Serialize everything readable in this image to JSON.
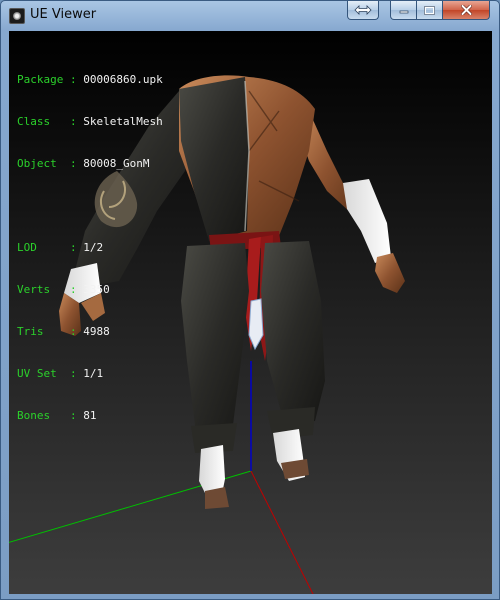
{
  "window": {
    "title": "UE Viewer",
    "icon": "ue-viewer-app-icon",
    "buttons": {
      "swap": "swap-arrows-icon",
      "minimize": "minimize-icon",
      "maximize": "maximize-icon",
      "close": "close-icon"
    }
  },
  "info": {
    "package_key": "Package :",
    "package": "00006860.upk",
    "class_key": "Class   :",
    "class": "SkeletalMesh",
    "object_key": "Object  :",
    "object": "80008_GonM",
    "lod_key": "LOD     :",
    "lod": "1/2",
    "verts_key": "Verts   :",
    "verts": "3350",
    "tris_key": "Tris    :",
    "tris": "4988",
    "uvset_key": "UV Set  :",
    "uvset": "1/1",
    "bones_key": "Bones   :",
    "bones": "81"
  },
  "colors": {
    "label": "#2bd12b",
    "value": "#f2f2f2",
    "axis_x": "#c00000",
    "axis_y": "#00c000",
    "axis_z": "#0000c8"
  }
}
